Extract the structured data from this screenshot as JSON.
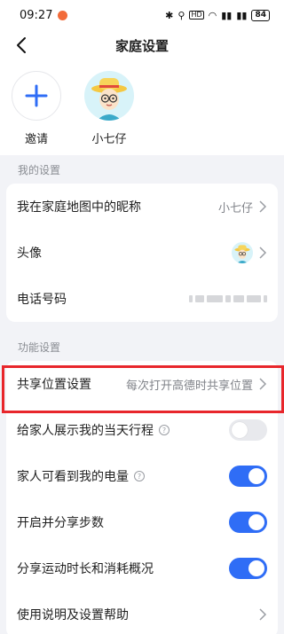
{
  "status_bar": {
    "time": "09:27",
    "battery": "84",
    "icons": [
      "bluetooth-icon",
      "location-icon",
      "hd-icon",
      "wifi-icon",
      "signal-icon",
      "signal-icon"
    ]
  },
  "header": {
    "title": "家庭设置"
  },
  "members": [
    {
      "label": "邀请",
      "icon": "plus-icon"
    },
    {
      "label": "小七仔",
      "icon": "avatar"
    }
  ],
  "my_settings": {
    "section_label": "我的设置",
    "nickname": {
      "label": "我在家庭地图中的昵称",
      "value": "小七仔"
    },
    "avatar": {
      "label": "头像"
    },
    "phone": {
      "label": "电话号码"
    }
  },
  "function_settings": {
    "section_label": "功能设置",
    "share_location": {
      "label": "共享位置设置",
      "value": "每次打开高德时共享位置"
    },
    "show_trip": {
      "label": "给家人展示我的当天行程",
      "enabled": false
    },
    "battery_visible": {
      "label": "家人可看到我的电量",
      "enabled": true
    },
    "share_steps": {
      "label": "开启并分享步数",
      "enabled": true
    },
    "share_exercise": {
      "label": "分享运动时长和消耗概况",
      "enabled": true
    },
    "help": {
      "label": "使用说明及设置帮助"
    }
  },
  "colors": {
    "accent": "#2f6df6",
    "highlight": "#e8262b",
    "background": "#f2f3f7"
  }
}
